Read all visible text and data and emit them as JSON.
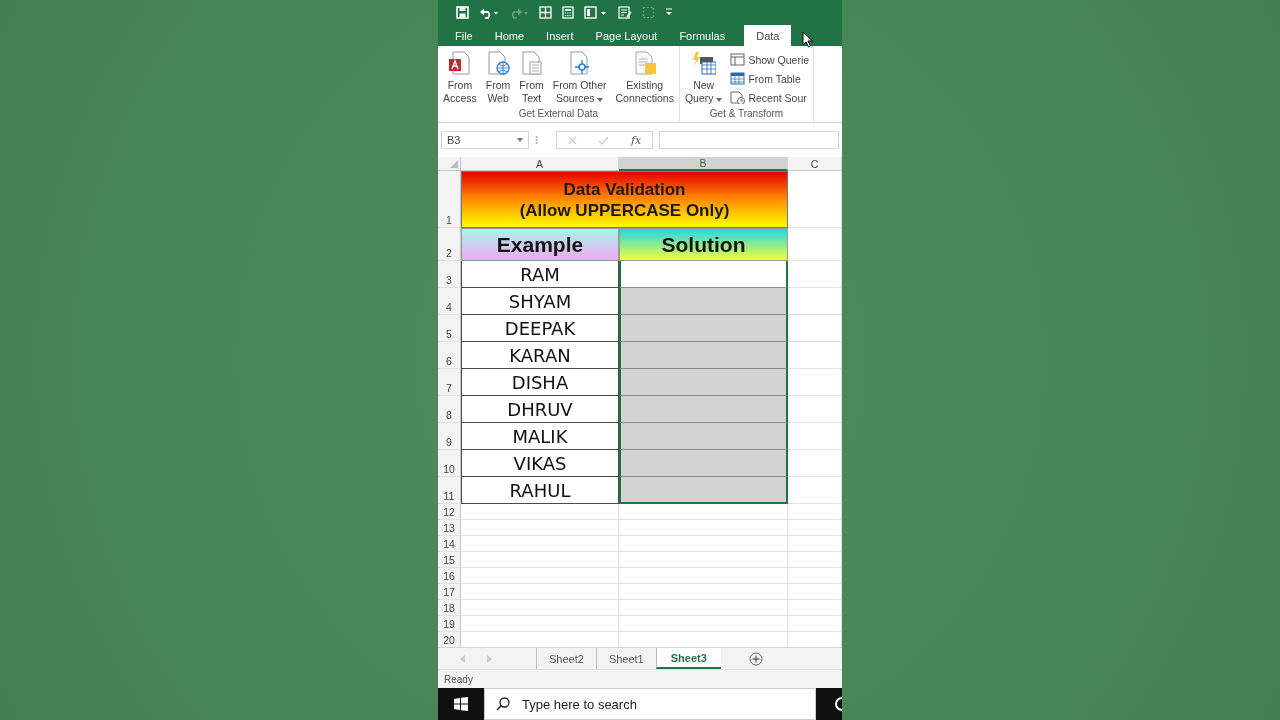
{
  "tabs": [
    {
      "label": "File",
      "selected": false
    },
    {
      "label": "Home",
      "selected": false
    },
    {
      "label": "Insert",
      "selected": false
    },
    {
      "label": "Page Layout",
      "selected": false
    },
    {
      "label": "Formulas",
      "selected": false
    },
    {
      "label": "Data",
      "selected": true
    }
  ],
  "ribbon": {
    "groups": [
      {
        "label": "Get External Data",
        "buttons": [
          {
            "kind": "access",
            "lines": [
              "From",
              "Access"
            ],
            "dropdown": false
          },
          {
            "kind": "web",
            "lines": [
              "From",
              "Web"
            ],
            "dropdown": false
          },
          {
            "kind": "text",
            "lines": [
              "From",
              "Text"
            ],
            "dropdown": false
          },
          {
            "kind": "other",
            "lines": [
              "From Other",
              "Sources"
            ],
            "dropdown": true
          },
          {
            "kind": "connections",
            "lines": [
              "Existing",
              "Connections"
            ],
            "dropdown": false
          }
        ]
      },
      {
        "label": "Get & Transform",
        "buttons": [
          {
            "kind": "query",
            "lines": [
              "New",
              "Query"
            ],
            "dropdown": true
          }
        ],
        "small_buttons": [
          {
            "kind": "queries",
            "label": "Show Querie"
          },
          {
            "kind": "table",
            "label": "From Table"
          },
          {
            "kind": "recent",
            "label": "Recent Sour"
          }
        ]
      }
    ]
  },
  "formula_bar": {
    "name_box": "B3",
    "function_symbol": "fx"
  },
  "columns": [
    {
      "label": "A",
      "selected": false
    },
    {
      "label": "B",
      "selected": true
    },
    {
      "label": "C",
      "selected": false
    }
  ],
  "title_row": {
    "number": "1",
    "lines": [
      "Data Validation",
      "(Allow UPPERCASE Only)"
    ]
  },
  "header_row": {
    "number": "2",
    "headers": [
      "Example",
      "Solution"
    ]
  },
  "rows": [
    {
      "number": "3",
      "example": "RAM",
      "highlighted": false
    },
    {
      "number": "4",
      "example": "SHYAM",
      "highlighted": true
    },
    {
      "number": "5",
      "example": "DEEPAK",
      "highlighted": true
    },
    {
      "number": "6",
      "example": "KARAN",
      "highlighted": true
    },
    {
      "number": "7",
      "example": "DISHA",
      "highlighted": true
    },
    {
      "number": "8",
      "example": "DHRUV",
      "highlighted": true
    },
    {
      "number": "9",
      "example": "MALIK",
      "highlighted": true
    },
    {
      "number": "10",
      "example": "VIKAS",
      "highlighted": true
    },
    {
      "number": "11",
      "example": "RAHUL",
      "highlighted": true
    }
  ],
  "empty_rows": [
    "12",
    "13",
    "14",
    "15",
    "16",
    "17",
    "18",
    "19",
    "20"
  ],
  "sheets": [
    {
      "label": "Sheet2",
      "selected": false
    },
    {
      "label": "Sheet1",
      "selected": false
    },
    {
      "label": "Sheet3",
      "selected": true
    }
  ],
  "status": "Ready",
  "taskbar": {
    "search_placeholder": "Type here to search"
  }
}
